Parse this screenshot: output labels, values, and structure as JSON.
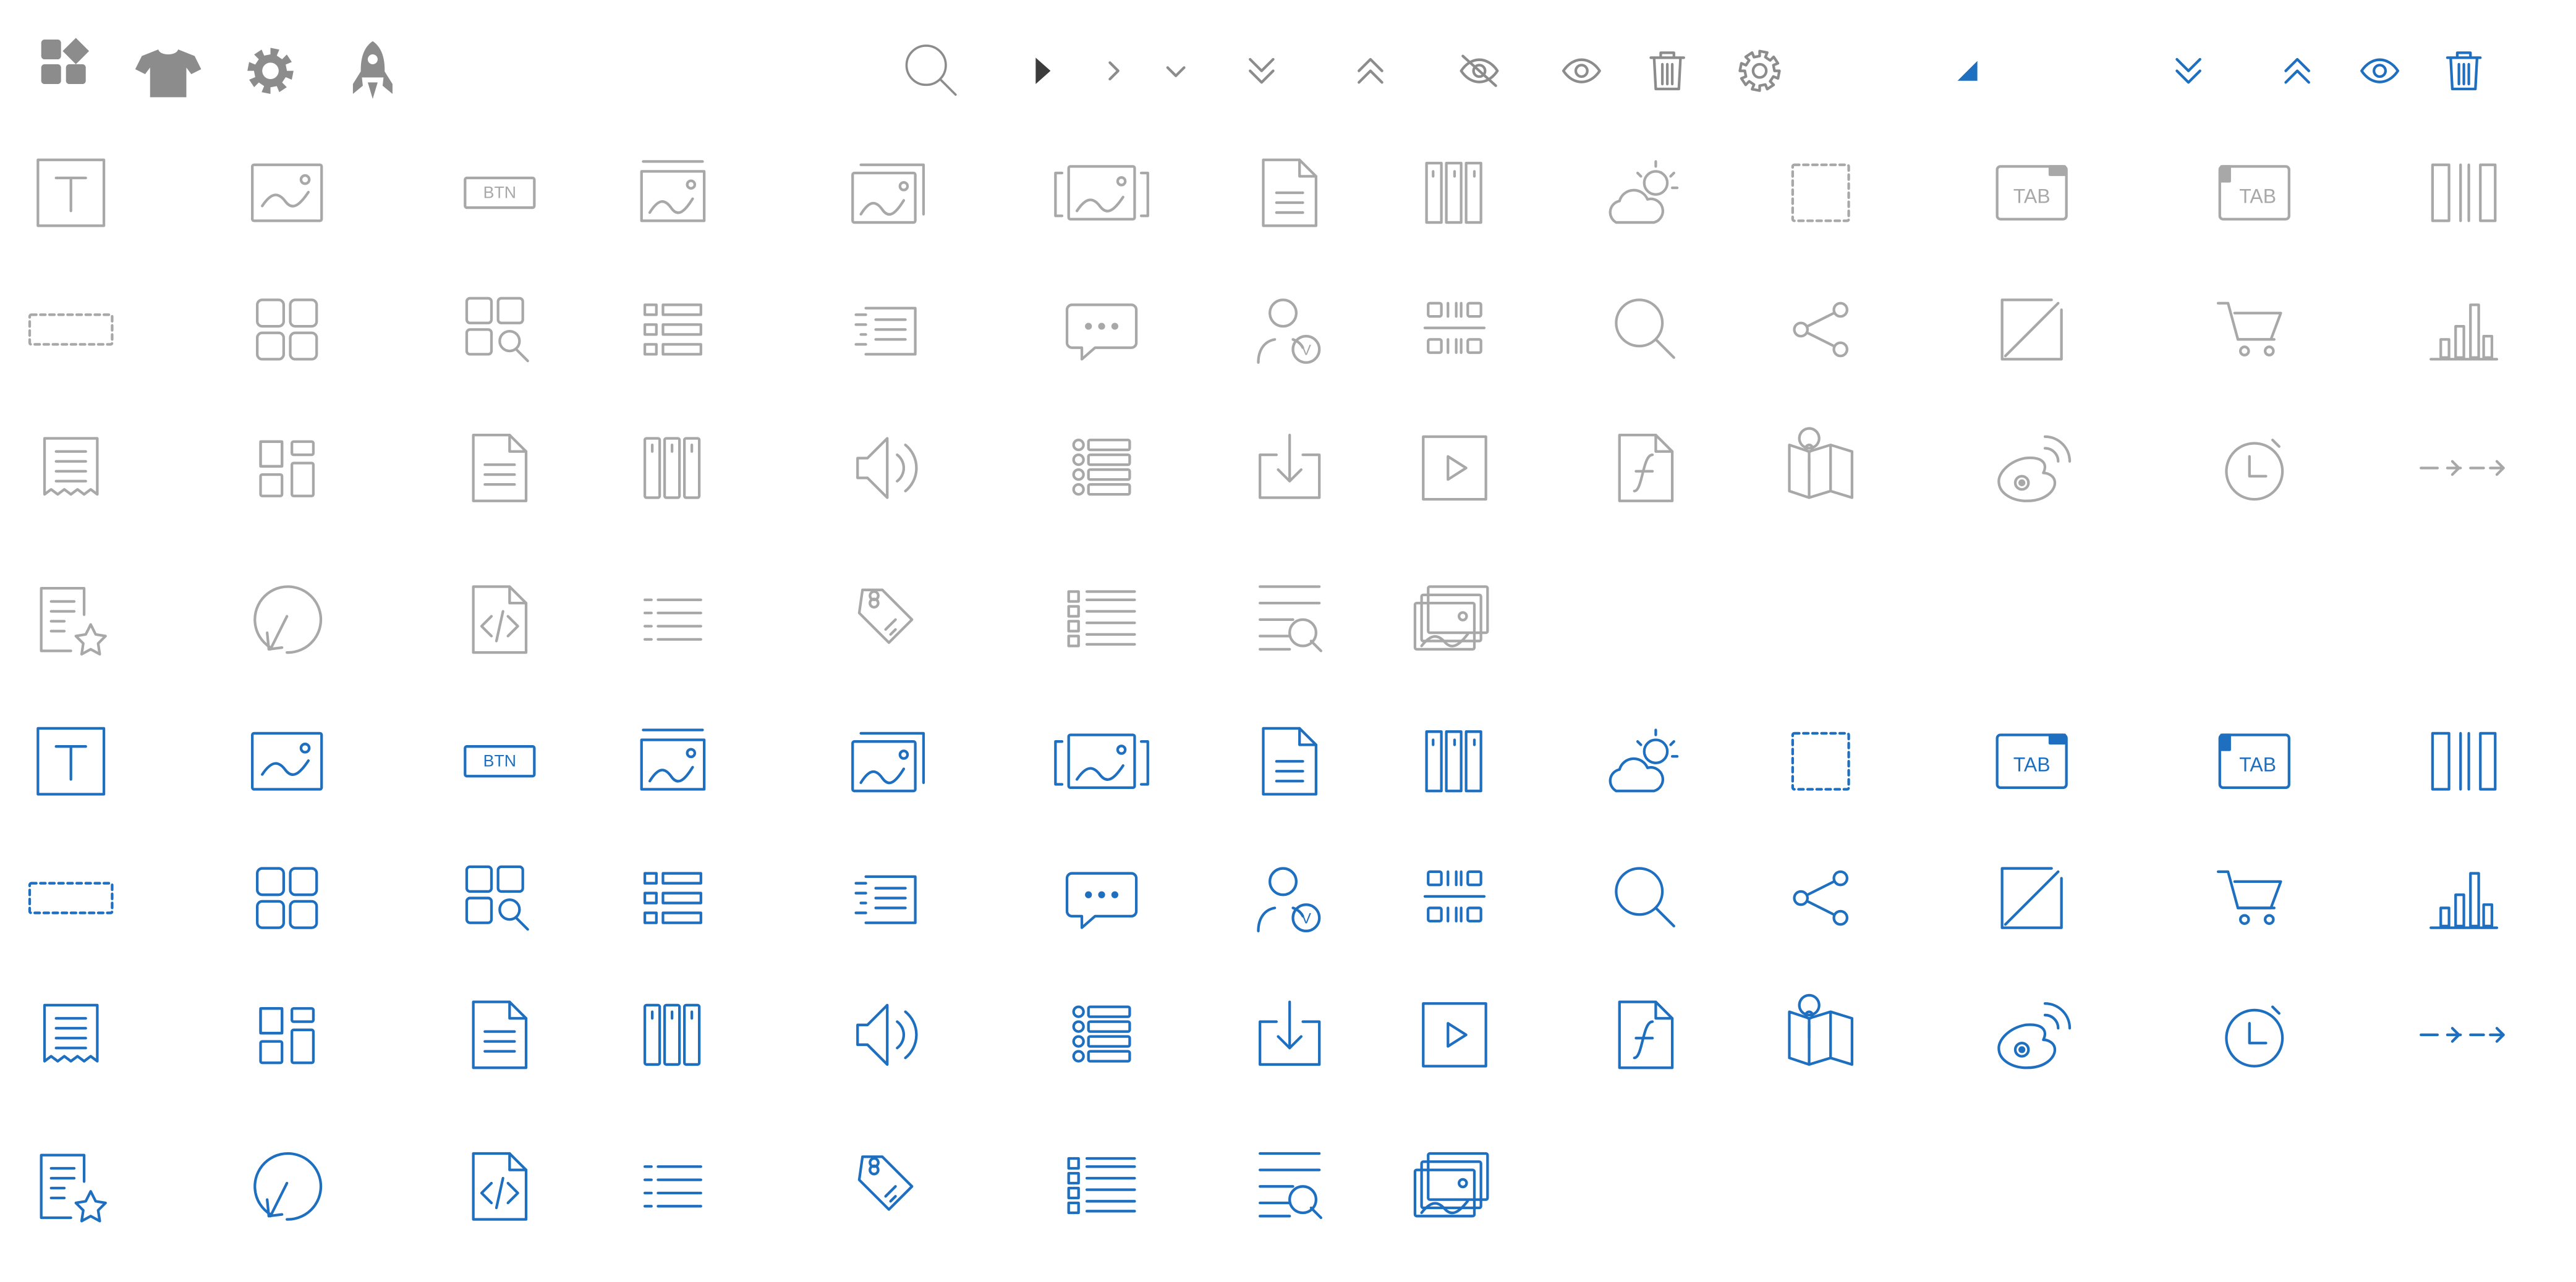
{
  "colors": {
    "gray": "#a8a8a8",
    "dark_gray": "#8c8c8c",
    "near_black": "#3c3c3c",
    "blue": "#1e6fc0"
  },
  "labels": {
    "btn": "BTN",
    "tab": "TAB",
    "verified": "V"
  },
  "toolbar_icons": [
    "components-icon",
    "tshirt-icon",
    "gear-icon",
    "rocket-icon",
    "search-icon",
    "caret-right-icon",
    "chevron-right-icon",
    "chevron-down-icon",
    "double-chevron-down-icon",
    "double-chevron-up-icon",
    "eye-slash-icon",
    "eye-icon",
    "trash-icon",
    "settings-icon",
    "corner-triangle-icon",
    "double-chevron-down-icon",
    "double-chevron-up-icon",
    "eye-icon",
    "trash-icon"
  ],
  "component_icons": [
    "text-icon",
    "image-icon",
    "button-icon",
    "banner-image-icon",
    "image-stack-icon",
    "image-carousel-icon",
    "document-icon",
    "columns-icon",
    "weather-icon",
    "placeholder-box-icon",
    "tab-right-icon",
    "tab-left-icon",
    "split-columns-icon",
    "input-box-icon",
    "grid-icon",
    "grid-search-icon",
    "list-view-icon",
    "news-list-icon",
    "comment-icon",
    "verified-user-icon",
    "barcode-icon",
    "search-icon",
    "share-icon",
    "diagonal-box-icon",
    "cart-icon",
    "bar-chart-icon",
    "receipt-icon",
    "dashboard-layout-icon",
    "page-icon",
    "three-columns-icon",
    "speaker-icon",
    "bullet-list-icon",
    "download-box-icon",
    "play-box-icon",
    "flash-file-icon",
    "map-icon",
    "weibo-icon",
    "timer-icon",
    "arrow-flow-icon",
    "favorite-doc-icon",
    "refresh-icon",
    "code-file-icon",
    "line-list-icon",
    "price-tag-icon",
    "checklist-icon",
    "text-search-icon",
    "photo-gallery-icon"
  ]
}
